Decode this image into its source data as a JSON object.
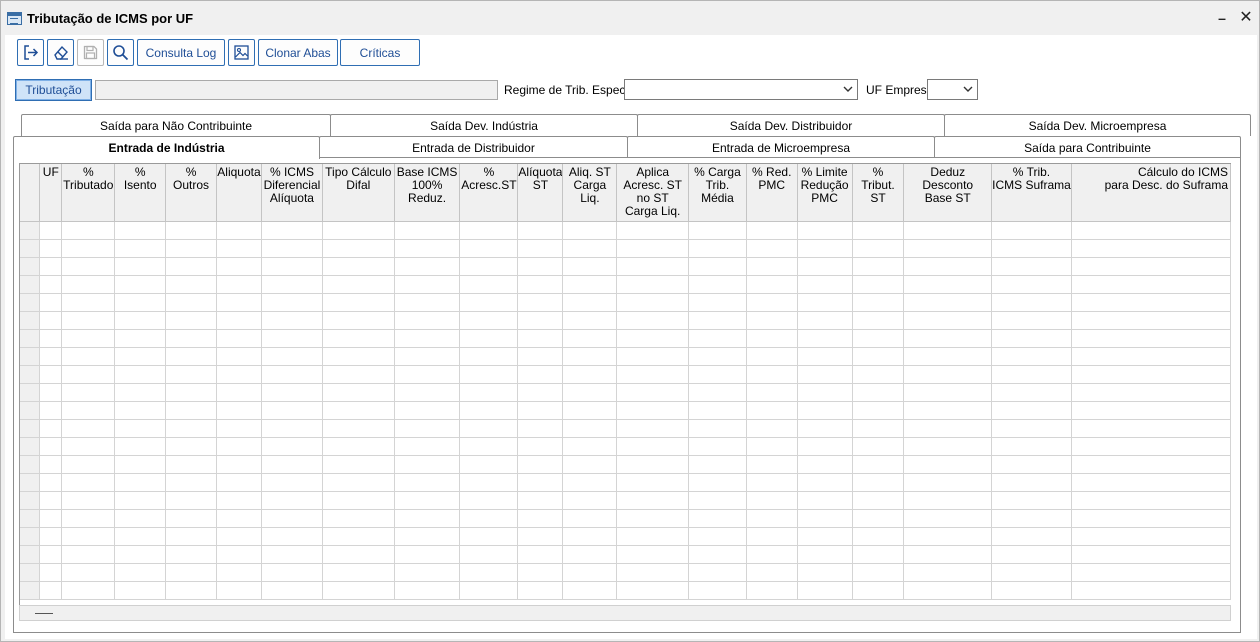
{
  "window": {
    "title": "Tributação de ICMS por UF"
  },
  "toolbar": {
    "consulta_log": "Consulta Log",
    "clonar_abas": "Clonar Abas",
    "criticas": "Críticas"
  },
  "filters": {
    "tributacao_button": "Tributação",
    "tributacao_value": "",
    "regime_label": "Regime de Trib. Especial",
    "regime_value": "",
    "uf_empresa_label": "UF Empresa",
    "uf_empresa_value": ""
  },
  "tabs_top": [
    "Saída para Não Contribuinte",
    "Saída Dev. Indústria",
    "Saída Dev. Distribuidor",
    "Saída Dev. Microempresa"
  ],
  "tabs_bottom": [
    "Entrada de Indústria",
    "Entrada de Distribuidor",
    "Entrada de Microempresa",
    "Saída para Contribuinte"
  ],
  "active_tab": "Entrada de Indústria",
  "grid": {
    "columns": [
      "",
      "UF",
      "%\nTributado",
      "%\nIsento",
      "%\nOutros",
      "Aliquota",
      "% ICMS\nDiferencial\nAlíquota",
      "Tipo Cálculo\nDifal",
      "Base ICMS\n100% Reduz.",
      "%\nAcresc.ST",
      "Alíquota\nST",
      "Aliq. ST\nCarga Liq.",
      "Aplica\nAcresc. ST\nno ST\nCarga Liq.",
      "% Carga\nTrib. Média",
      "% Red.\nPMC",
      "% Limite\nRedução\nPMC",
      "%\nTribut. ST",
      "Deduz Desconto\nBase ST",
      "% Trib.\nICMS Suframa",
      "Cálculo do ICMS\npara Desc. do Suframa"
    ],
    "rows": 21
  }
}
